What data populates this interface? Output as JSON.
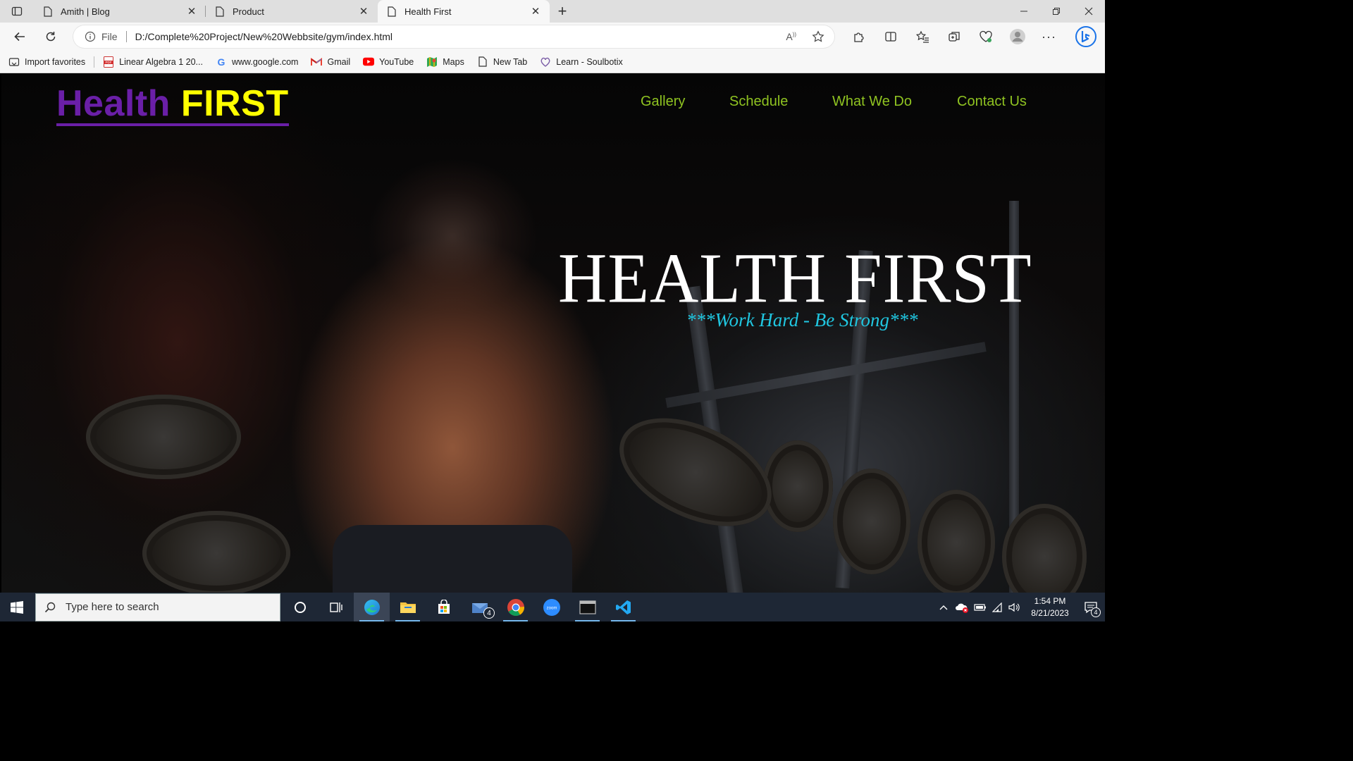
{
  "browser": {
    "tabs": [
      {
        "title": "Amith | Blog",
        "active": false
      },
      {
        "title": "Product",
        "active": false
      },
      {
        "title": "Health First",
        "active": true
      }
    ],
    "address": {
      "scheme_label": "File",
      "url": "D:/Complete%20Project/New%20Webbsite/gym/index.html"
    },
    "favorites": [
      {
        "label": "Import favorites",
        "icon": "import-icon"
      },
      {
        "label": "Linear Algebra 1 20...",
        "icon": "pdf-icon"
      },
      {
        "label": "www.google.com",
        "icon": "google-icon"
      },
      {
        "label": "Gmail",
        "icon": "gmail-icon"
      },
      {
        "label": "YouTube",
        "icon": "youtube-icon"
      },
      {
        "label": "Maps",
        "icon": "maps-icon"
      },
      {
        "label": "New Tab",
        "icon": "page-icon"
      },
      {
        "label": "Learn - Soulbotix",
        "icon": "soulbotix-icon"
      }
    ]
  },
  "site": {
    "brand_part1": "Health",
    "brand_part2": "FIRST",
    "nav": [
      "Gallery",
      "Schedule",
      "What We Do",
      "Contact Us"
    ],
    "hero_title": "HEALTH FIRST",
    "hero_subtitle": "***Work Hard - Be Strong***",
    "colors": {
      "brand_purple": "#6a1fa7",
      "brand_yellow": "#ffff00",
      "nav_green": "#8fc321",
      "subtitle_cyan": "#20c6e0"
    }
  },
  "taskbar": {
    "search_placeholder": "Type here to search",
    "mail_badge": "4",
    "time": "1:54 PM",
    "date": "8/21/2023",
    "notification_count": "4"
  }
}
